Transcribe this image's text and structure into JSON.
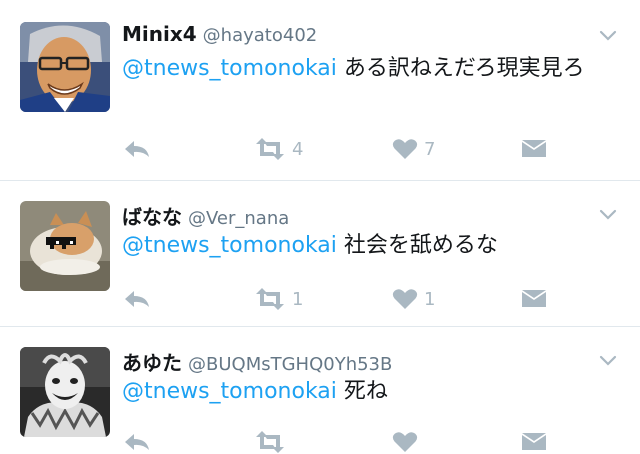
{
  "tweets": [
    {
      "name": "Minix4",
      "handle": "@hayato402",
      "mention": "@tnews_tomonokai",
      "body": " ある訳ねえだろ現実見ろ",
      "retweets": "4",
      "likes": "7",
      "avatar_icon": "grinning-man-glasses-avatar"
    },
    {
      "name": "ばなな",
      "handle": "@Ver_nana",
      "mention": "@tnews_tomonokai",
      "body": " 社会を舐めるな",
      "retweets": "1",
      "likes": "1",
      "avatar_icon": "cat-sunglasses-avatar"
    },
    {
      "name": "あゆた",
      "handle": "@BUQMsTGHQ0Yh53B",
      "mention": "@tnews_tomonokai",
      "body": " 死ね",
      "retweets": "",
      "likes": "",
      "avatar_icon": "clown-ruff-avatar"
    }
  ],
  "colors": {
    "link": "#1da1f2",
    "icon": "#aab8c2",
    "handle": "#657786"
  }
}
